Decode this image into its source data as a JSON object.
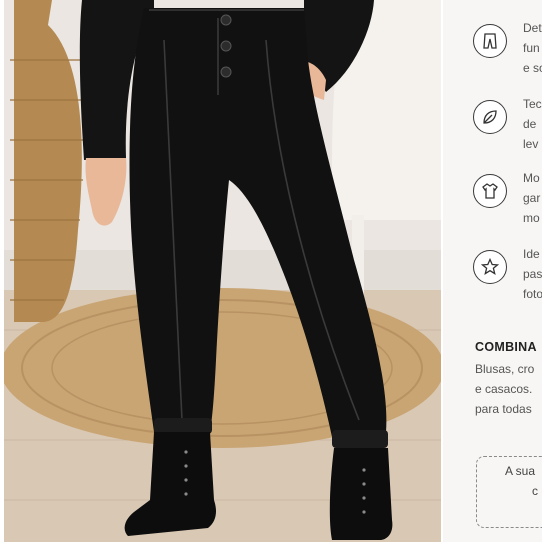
{
  "product_photo": {
    "alt": "Criança vestindo calça jogger de couro sintético preta com botas pretas"
  },
  "features": [
    {
      "icon": "pants-icon",
      "lines": [
        "Det",
        "fun",
        "e so"
      ]
    },
    {
      "icon": "leaf-icon",
      "lines": [
        "Tec",
        "de",
        "lev"
      ]
    },
    {
      "icon": "tshirt-icon",
      "lines": [
        "Mo",
        "gar",
        "mo"
      ]
    },
    {
      "icon": "star-icon",
      "lines": [
        "Ide",
        "pas",
        "foto"
      ]
    }
  ],
  "combine": {
    "title": "COMBINA",
    "lines": [
      "Blusas, cro",
      "e casacos.",
      "para todas"
    ]
  },
  "cta": {
    "lines": [
      "A sua",
      "c"
    ]
  }
}
